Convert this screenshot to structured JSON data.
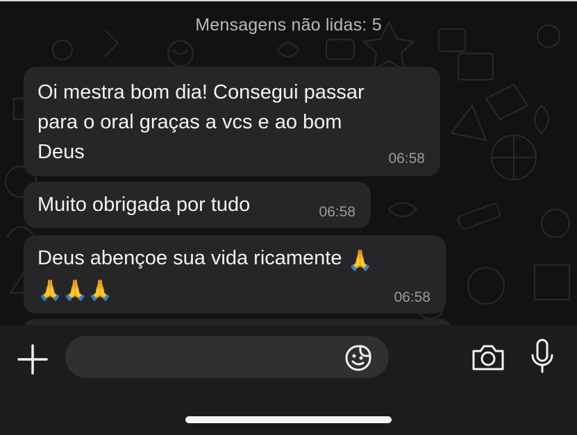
{
  "chat": {
    "unread_banner": "Mensagens não lidas: 5",
    "messages": [
      {
        "text": "Oi mestra bom dia! Consegui passar\npara o oral graças a vcs e ao bom\nDeus",
        "time": "06:58"
      },
      {
        "text": "Muito obrigada por tudo",
        "time": "06:58"
      },
      {
        "text_line1": "Deus abençoe sua vida ricamente",
        "emoji": "🙏",
        "emoji_line2": "🙏🙏🙏",
        "time": "06:58"
      }
    ]
  },
  "composer": {
    "input_value": "",
    "icons": {
      "attach": "plus-icon",
      "sticker": "sticker-icon",
      "camera": "camera-icon",
      "voice": "microphone-icon"
    }
  },
  "colors": {
    "bubble": "#262628",
    "background": "#121212",
    "input_bar": "#1c1c1e",
    "time_text": "#9a9a9a"
  }
}
